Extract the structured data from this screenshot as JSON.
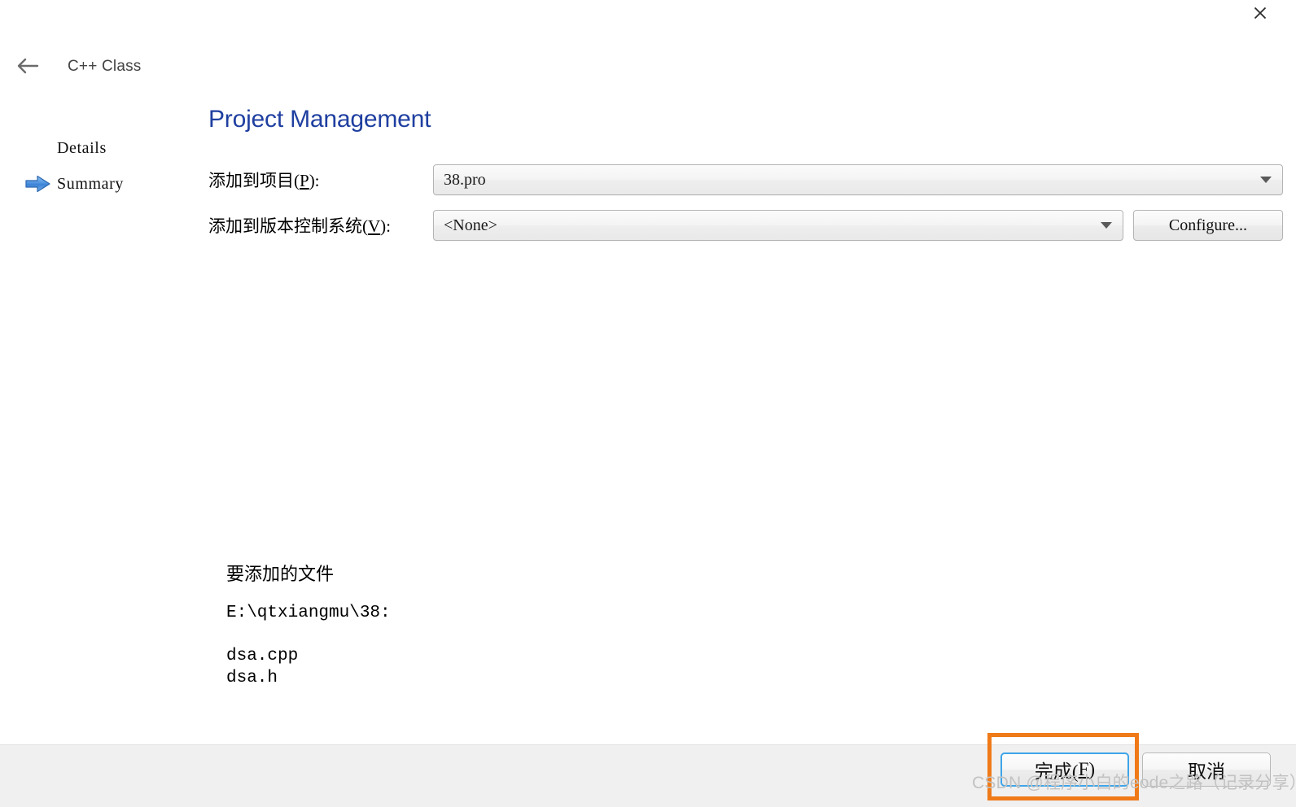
{
  "window": {
    "close_label": "✕"
  },
  "header": {
    "back_icon": "arrow-left-icon",
    "title": "C++ Class"
  },
  "steps": [
    {
      "label": "Details",
      "marker": "",
      "current": false
    },
    {
      "label": "Summary",
      "marker": "arrow-right-icon",
      "current": true
    }
  ],
  "main": {
    "page_title": "Project Management",
    "fields": {
      "project": {
        "label_prefix": "添加到项目(",
        "label_accel": "P",
        "label_suffix": "):",
        "value": "38.pro"
      },
      "vcs": {
        "label_prefix": "添加到版本控制系统(",
        "label_accel": "V",
        "label_suffix": "):",
        "value": "<None>",
        "configure_label": "Configure..."
      }
    },
    "files": {
      "heading": "要添加的文件",
      "path": "E:\\qtxiangmu\\38:",
      "entries": [
        "dsa.cpp",
        "dsa.h"
      ]
    }
  },
  "footer": {
    "finish_prefix": "完成(",
    "finish_accel": "F",
    "finish_suffix": ")",
    "cancel_label": "取消"
  },
  "annotation": {
    "highlight_color": "#f07a18"
  },
  "watermark": {
    "text": "CSDN @程序小白的eode之路（记录分享）"
  }
}
